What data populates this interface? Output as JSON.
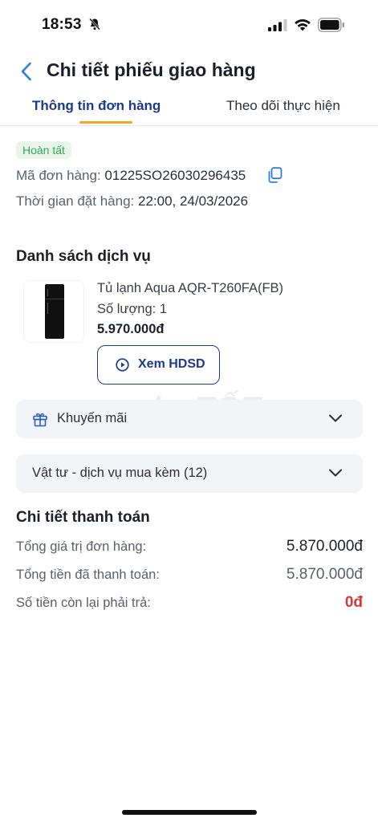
{
  "status_bar": {
    "time": "18:53",
    "icons": [
      "bell-muted-icon",
      "signal-icon",
      "wifi-icon",
      "battery-icon"
    ]
  },
  "header": {
    "title": "Chi tiết phiếu giao hàng",
    "back_icon": "chevron-left-icon"
  },
  "tabs": [
    {
      "label": "Thông tin đơn hàng",
      "active": true
    },
    {
      "label": "Theo dõi thực hiện",
      "active": false
    }
  ],
  "order": {
    "status_badge": "Hoàn tất",
    "code_label": "Mã đơn hàng:",
    "code_value": "01225SO26030296435",
    "time_label": "Thời gian đặt hàng:",
    "time_value": "22:00, 24/03/2026"
  },
  "services": {
    "title": "Danh sách dịch vụ",
    "product": {
      "name": "Tủ lạnh Aqua AQR-T260FA(FB)",
      "quantity": "Số lượng: 1",
      "price": "5.970.000đ",
      "manual_button": "Xem HDSD"
    }
  },
  "accordions": {
    "promo": "Khuyến mãi",
    "supplies": "Vật tư - dịch vụ mua kèm (12)"
  },
  "payment": {
    "title": "Chi tiết thanh toán",
    "rows": [
      {
        "label": "Tổng giá trị đơn hàng:",
        "amount": "5.870.000đ"
      },
      {
        "label": "Tổng tiền đã thanh toán:",
        "amount": "5.870.000đ"
      },
      {
        "label": "Số tiền còn lại phải trả:",
        "amount": "0đ"
      }
    ]
  },
  "watermark": "chợTỐT",
  "colors": {
    "accent": "#1e3a8a",
    "tab_indicator": "#f5a623",
    "status_green": "#3aa658",
    "status_green_bg": "#e8f5ea",
    "due_red": "#d6393b",
    "link_blue": "#2a7de1"
  }
}
